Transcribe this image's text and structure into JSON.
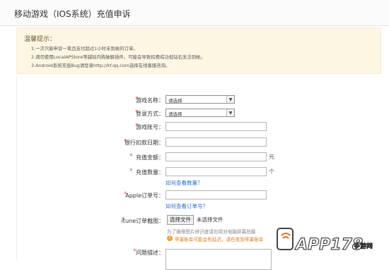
{
  "header": {
    "title": "移动游戏（IOS系统）充值申诉"
  },
  "notice": {
    "title": "温馨提示：",
    "lines": [
      "1.一次只能申诉一笔且支付超过1小时未到帐的订单。",
      "2.请勿使用LocalAPStore等越狱内购破解插件，可能会导致扣费成功但钻石无法到帐。",
      "3.Android系统充值Bug请登录http://kf.qq.com选择在线客服咨询。"
    ]
  },
  "form": {
    "game_name": {
      "required": "*",
      "label": "游戏名称：",
      "value": "请选择"
    },
    "login_method": {
      "required": "*",
      "label": "登录方式：",
      "value": "请选择"
    },
    "game_account": {
      "required": "*",
      "label": "游戏账号："
    },
    "bank_date": {
      "required": "*",
      "label": "银行扣款日期："
    },
    "amount": {
      "required": "*",
      "label": "充值金额：",
      "unit": "元"
    },
    "quantity": {
      "required": "*",
      "label": "充值数量：",
      "unit": "个",
      "help_link": "如何查看数量？"
    },
    "apple_order": {
      "required": "*",
      "label": "Apple订单号：",
      "help_link": "如何查看订单号？"
    },
    "itunes_screenshot": {
      "required": "*",
      "label": "itune订单截图：",
      "button": "选择文件",
      "no_file": "未选择文件",
      "hint": "为了确保图片辨识度请勿用对电脑屏幕拍摄",
      "warning": "苹果账单可能会有延迟，请在收到苹果账单"
    },
    "description": {
      "required": "*",
      "label": "问题描述："
    }
  },
  "watermark": {
    "text": "APP178",
    "sub": "手游网"
  },
  "colors": {
    "required": "#d9534f",
    "link": "#2a72c8",
    "notice_bg": "#fdf6e3",
    "warning": "#e0781a"
  }
}
